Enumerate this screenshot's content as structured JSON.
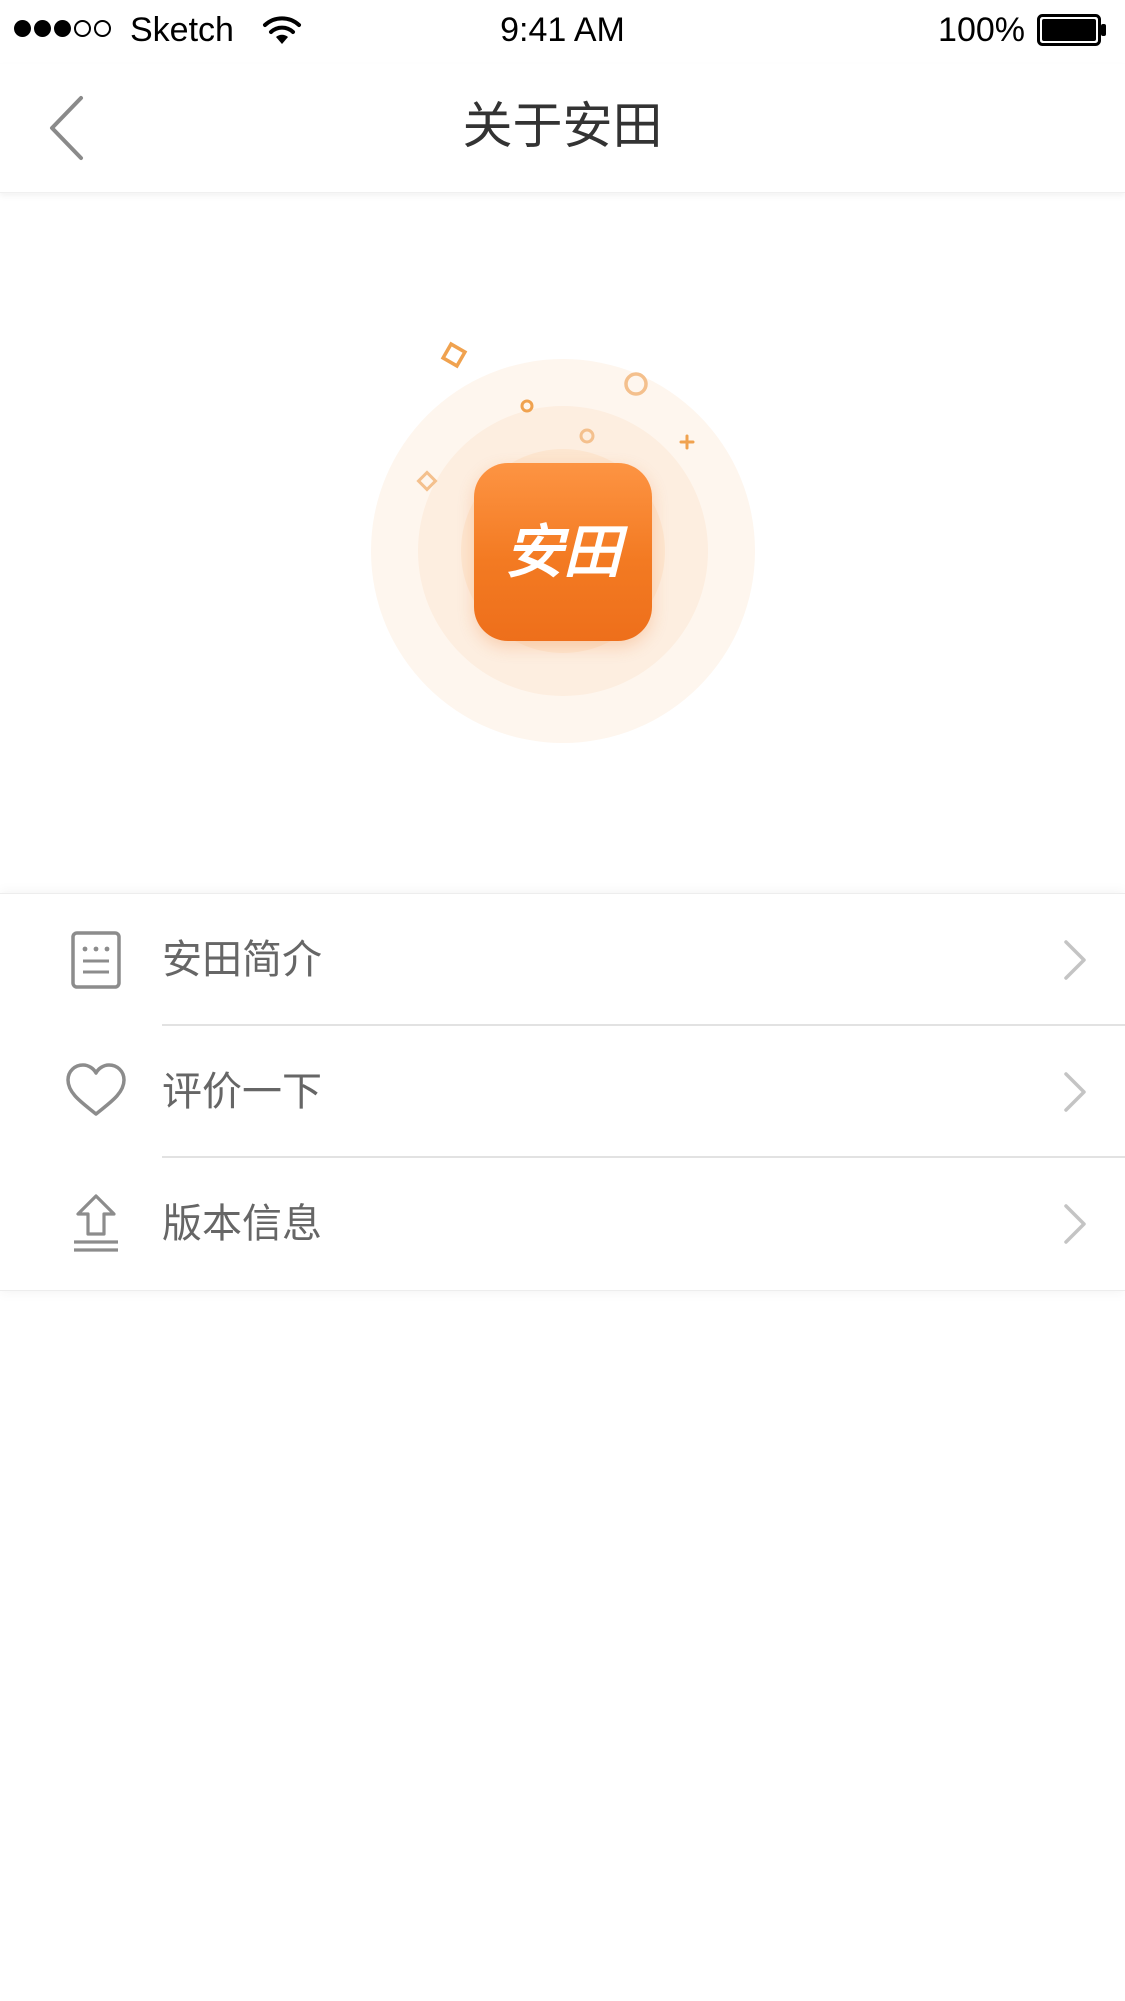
{
  "status_bar": {
    "carrier": "Sketch",
    "time": "9:41 AM",
    "battery_percent": "100%",
    "signal_bars_filled": 3,
    "signal_bars_total": 5
  },
  "nav": {
    "title": "关于安田",
    "back_icon": "chevron-left-icon"
  },
  "hero": {
    "logo_text": "安田",
    "colors": {
      "accent": "#f37a22",
      "accent_light": "#fd9443",
      "halo": "#fde9d6"
    }
  },
  "menu": {
    "items": [
      {
        "label": "安田简介",
        "icon": "document-icon"
      },
      {
        "label": "评价一下",
        "icon": "heart-icon"
      },
      {
        "label": "版本信息",
        "icon": "upload-icon"
      }
    ]
  }
}
